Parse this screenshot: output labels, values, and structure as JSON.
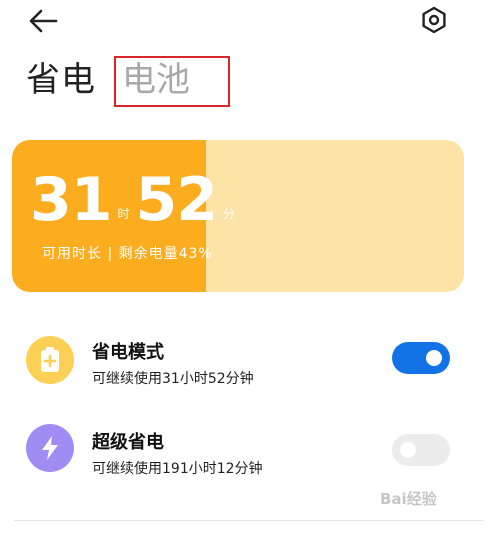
{
  "header": {
    "back_icon": "arrow-left-icon",
    "settings_icon": "hexagon-settings-icon"
  },
  "tabs": [
    {
      "label": "省电",
      "selected": true
    },
    {
      "label": "电池",
      "selected": false
    }
  ],
  "battery": {
    "hours": "31",
    "hours_unit": "时",
    "minutes": "52",
    "minutes_unit": "分",
    "subtitle": "可用时长 | 剩余电量43%",
    "level_percent": 43
  },
  "modes": [
    {
      "title": "省电模式",
      "description": "可继续使用31小时52分钟",
      "icon": "battery-plus-icon",
      "icon_color": "#fccf55",
      "enabled": true
    },
    {
      "title": "超级省电",
      "description": "可继续使用191小时12分钟",
      "icon": "lightning-icon",
      "icon_color": "#a08cf2",
      "enabled": false
    }
  ],
  "colors": {
    "accent": "#1372e6",
    "battery_fill": "#fbad1f",
    "battery_bg": "#fde4a6",
    "highlight_box": "#d9262b"
  },
  "watermark": "Bai经验"
}
